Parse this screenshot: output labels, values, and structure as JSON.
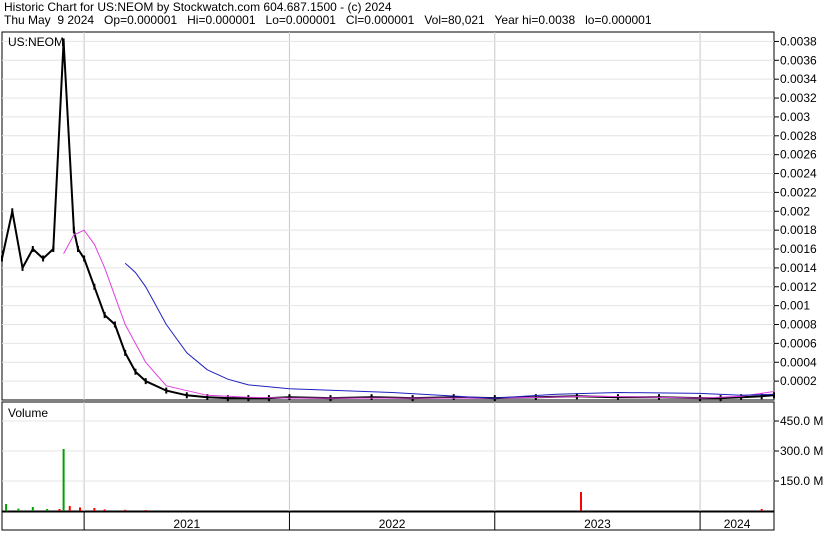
{
  "header": {
    "line1": "Historic Chart for US:NEOM by Stockwatch.com 604.687.1500 - (c) 2024",
    "line2": "Thu May  9 2024   Op=0.000001   Hi=0.000001   Lo=0.000001   Cl=0.000001   Vol=80,021   Year hi=0.0038   lo=0.000001"
  },
  "chart_data": [
    {
      "type": "line",
      "title": "US:NEOM",
      "ylim": [
        0,
        0.0039
      ],
      "yticks": [
        "0.0038",
        "0.0036",
        "0.0034",
        "0.0032",
        "0.003",
        "0.0028",
        "0.0026",
        "0.0024",
        "0.0022",
        "0.002",
        "0.0018",
        "0.0016",
        "0.0014",
        "0.0012",
        "0.001",
        "0.0008",
        "0.0006",
        "0.0004",
        "0.0002"
      ],
      "x_labels": [
        "2021",
        "2022",
        "2023",
        "2024"
      ],
      "grid": true,
      "colors": {
        "price": "#000000",
        "ma_short": "#e040e0",
        "ma_long": "#2020c0",
        "marker": "#ff0000"
      },
      "series": [
        {
          "style": "price",
          "x": [
            2020.6,
            2020.65,
            2020.7,
            2020.75,
            2020.8,
            2020.85,
            2020.9,
            2020.95,
            2020.97,
            2021.0,
            2021.05,
            2021.1,
            2021.15,
            2021.2,
            2021.25,
            2021.3,
            2021.4,
            2021.5,
            2021.6,
            2021.7,
            2021.8,
            2021.9,
            2022.0,
            2022.2,
            2022.4,
            2022.6,
            2022.8,
            2023.0,
            2023.2,
            2023.4,
            2023.6,
            2023.8,
            2024.0,
            2024.1,
            2024.2,
            2024.3,
            2024.36
          ],
          "y": [
            0.0015,
            0.002,
            0.0014,
            0.0016,
            0.0015,
            0.0016,
            0.0038,
            0.0018,
            0.0016,
            0.0015,
            0.0012,
            0.0009,
            0.0008,
            0.0005,
            0.0003,
            0.0002,
            0.0001,
            5e-05,
            3e-05,
            2e-05,
            2e-05,
            2e-05,
            3e-05,
            2e-05,
            3e-05,
            2e-05,
            3e-05,
            2e-05,
            3e-05,
            4e-05,
            3e-05,
            3e-05,
            2e-05,
            2e-05,
            3e-05,
            4e-05,
            5e-05
          ]
        },
        {
          "style": "ma_short",
          "x": [
            2020.9,
            2020.95,
            2021.0,
            2021.05,
            2021.1,
            2021.15,
            2021.2,
            2021.3,
            2021.4,
            2021.6,
            2021.8,
            2022.0,
            2022.5,
            2023.0,
            2023.5,
            2024.0,
            2024.2,
            2024.36
          ],
          "y": [
            0.00155,
            0.00175,
            0.0018,
            0.00165,
            0.0014,
            0.0011,
            0.0008,
            0.0004,
            0.00015,
            5e-05,
            3e-05,
            2e-05,
            2e-05,
            2e-05,
            4e-05,
            2e-05,
            4e-05,
            9e-05
          ]
        },
        {
          "style": "ma_long",
          "x": [
            2021.2,
            2021.25,
            2021.3,
            2021.4,
            2021.5,
            2021.6,
            2021.7,
            2021.8,
            2022.0,
            2022.5,
            2022.9,
            2023.0,
            2023.3,
            2023.6,
            2024.0,
            2024.2,
            2024.36
          ],
          "y": [
            0.00145,
            0.00135,
            0.0012,
            0.0008,
            0.0005,
            0.00032,
            0.00022,
            0.00016,
            0.00012,
            8e-05,
            3e-05,
            2e-05,
            6e-05,
            8e-05,
            7e-05,
            5e-05,
            6e-05
          ]
        }
      ]
    },
    {
      "type": "bar",
      "title": "Volume",
      "ylim": [
        0,
        525
      ],
      "yticks": [
        "450.0 M",
        "300.0 M",
        "150.0 M"
      ],
      "x_labels": [
        "2021",
        "2022",
        "2023",
        "2024"
      ],
      "colors": {
        "up": "#00a000",
        "down": "#ff0000"
      },
      "x": [
        2020.62,
        2020.68,
        2020.75,
        2020.82,
        2020.88,
        2020.9,
        2020.93,
        2020.98,
        2021.05,
        2021.1,
        2021.2,
        2021.3,
        2023.42,
        2024.3
      ],
      "values": [
        35,
        12,
        20,
        10,
        10,
        310,
        25,
        18,
        15,
        8,
        6,
        5,
        95,
        10
      ]
    }
  ]
}
